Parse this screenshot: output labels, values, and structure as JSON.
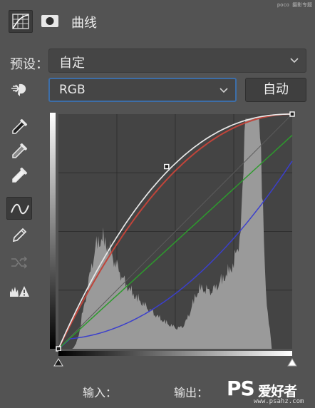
{
  "header": {
    "title": "曲线",
    "adjustment_icon": "curves-adjustment-icon",
    "mask_icon": "layer-mask-icon",
    "watermark": "poco 摄影专题"
  },
  "preset": {
    "label": "预设：",
    "value": "自定"
  },
  "channel": {
    "value": "RGB",
    "auto_label": "自动"
  },
  "tools": [
    {
      "name": "on-image-adjust-icon"
    },
    {
      "name": "black-point-eyedropper-icon"
    },
    {
      "name": "gray-point-eyedropper-icon"
    },
    {
      "name": "white-point-eyedropper-icon"
    },
    {
      "name": "edit-points-curve-icon",
      "selected": true
    },
    {
      "name": "pencil-draw-icon"
    },
    {
      "name": "smooth-curve-icon"
    },
    {
      "name": "clipping-warning-icon"
    }
  ],
  "curves": {
    "colors": {
      "rgb": "#e8e8e8",
      "red": "#c0443a",
      "green": "#2d9a2d",
      "blue": "#3b3fcc",
      "histogram": "#9a9a9a",
      "background": "#444444"
    },
    "rgb_points": [
      [
        0,
        0
      ],
      [
        255,
        255
      ]
    ],
    "control_points": [
      [
        0,
        0
      ],
      [
        118,
        198
      ],
      [
        255,
        255
      ]
    ]
  },
  "io": {
    "input_label": "输入：",
    "output_label": "输出："
  },
  "branding": {
    "ps": "PS",
    "name": "爱好者",
    "url": "www.psahz.com"
  }
}
